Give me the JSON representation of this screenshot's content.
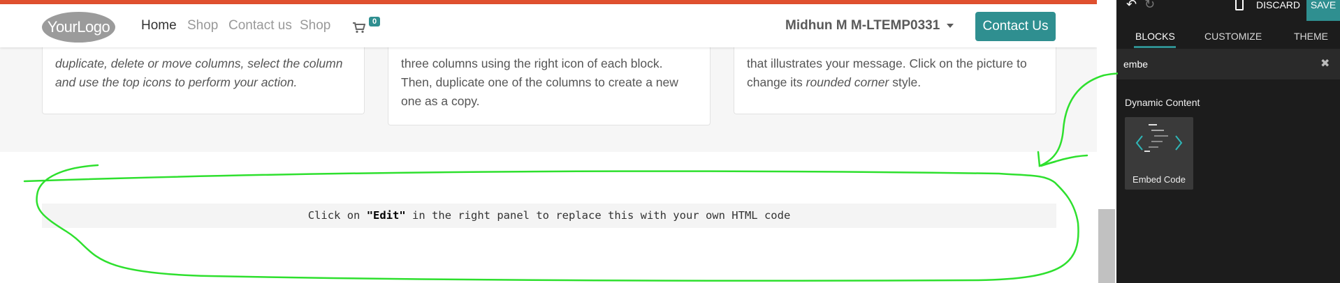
{
  "navbar": {
    "logo_text": "YourLogo",
    "links": [
      "Home",
      "Shop",
      "Contact us",
      "Shop"
    ],
    "cart_count": "0",
    "user_name": "Midhun M M-LTEMP0331",
    "contact_button": "Contact Us"
  },
  "cards": [
    {
      "lines": [
        "duplicate, delete or move columns, select the column",
        "and use the top icons to perform your action."
      ]
    },
    {
      "lines": [
        "three columns using the right icon of each block.",
        "Then, duplicate one of the columns to create a new",
        "one as a copy."
      ]
    },
    {
      "line1_text": "that illustrates your message. Click on the picture to",
      "line2_before": "change its ",
      "line2_italic": "rounded corner",
      "line2_after": " style."
    }
  ],
  "embed": {
    "before": "Click on ",
    "bold": "\"Edit\"",
    "after": " in the right panel to replace this with your own HTML code"
  },
  "panel": {
    "discard_label": "DISCARD",
    "save_label": "SAVE",
    "tabs": [
      "BLOCKS",
      "CUSTOMIZE",
      "THEME"
    ],
    "active_tab": "BLOCKS",
    "search_value": "embe",
    "category": "Dynamic Content",
    "block_label": "Embed Code"
  },
  "colors": {
    "accent": "#2f8f90",
    "top_bar": "#e0502f",
    "annotation": "#2ee02e",
    "panel_bg": "#1c1c1c"
  },
  "icons": [
    "undo-icon",
    "redo-icon",
    "mobile-preview-icon",
    "cart-icon",
    "clear-search-icon",
    "embed-code-icon",
    "dropdown-caret-icon"
  ]
}
